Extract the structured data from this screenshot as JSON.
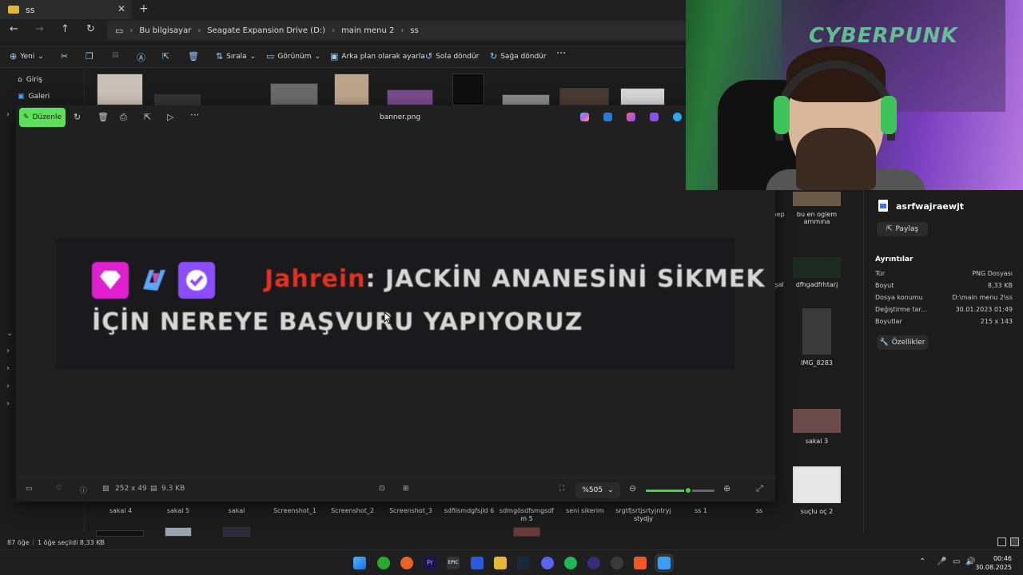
{
  "explorer": {
    "tab_title": "ss",
    "breadcrumbs": [
      "Bu bilgisayar",
      "Seagate Expansion Drive (D:)",
      "main menu 2",
      "ss"
    ],
    "commands": {
      "new": "Yeni",
      "sort": "Sırala",
      "view": "Görünüm",
      "set_background": "Arka plan olarak ayarla",
      "rotate_left": "Sola döndür",
      "rotate_right": "Sağa döndür"
    },
    "nav": {
      "home": "Giriş",
      "gallery": "Galeri"
    },
    "bottom_labels": [
      "sakal 4",
      "sakal 5",
      "sakal",
      "Screenshot_1",
      "Screenshot_2",
      "Screenshot_3",
      "sdfilsmdgfsjld 6",
      "sdmgösdfsmgsdf m 5",
      "seni sikerim",
      "srgtfjsrtjsrtyjntryj stydjy",
      "ss 1",
      "ss"
    ],
    "right_labels": [
      "hep",
      "bu en oglem ammına",
      "işal",
      "dfhgadfrhtarj",
      "IMG_8283",
      "sakal 3",
      "suçlu oç 2"
    ],
    "status": {
      "count": "87 öğe",
      "selected": "1 öğe seçildi  8,33 KB"
    }
  },
  "details": {
    "filename": "asrfwajraewjt",
    "share": "Paylaş",
    "section_title": "Ayrıntılar",
    "rows": [
      {
        "label": "Tür",
        "value": "PNG Dosyası"
      },
      {
        "label": "Boyut",
        "value": "8,33 KB"
      },
      {
        "label": "Dosya konumu",
        "value": "D:\\main menu 2\\ss"
      },
      {
        "label": "Değiştirme tar...",
        "value": "30.01.2023 01:49"
      },
      {
        "label": "Boyutlar",
        "value": "215 x 143"
      }
    ],
    "properties": "Özellikler"
  },
  "viewer": {
    "edit": "Düzenle",
    "title": "banner.png",
    "chat": {
      "username": "Jahrein",
      "message_line1": ": JACKİN ANANESİNİ SİKMEK",
      "message_line2": "İÇİN NEREYE BAŞVURU YAPIYORUZ"
    },
    "dimensions": "252 x 49",
    "filesize": "9.3 KB",
    "zoom": "%505",
    "zoom_level": 0.62
  },
  "webcam": {
    "poster_text": "CYBERPUNK"
  },
  "taskbar": {
    "time": "00:46",
    "date": "30.08.2025"
  },
  "colors": {
    "accent_green": "#5ce05c",
    "username_red": "#e0321e",
    "badge_magenta": "#e020d0",
    "badge_purple": "#8a4dff"
  }
}
